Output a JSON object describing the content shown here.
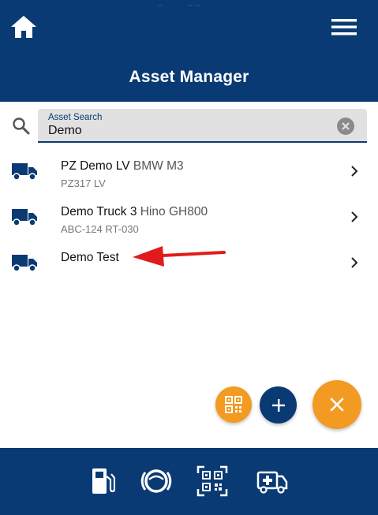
{
  "header": {
    "title": "Asset Manager",
    "background_color": "#0a3a73",
    "home_icon": "home-icon",
    "menu_icon": "hamburger-menu-icon"
  },
  "search": {
    "label": "Asset Search",
    "value": "Demo",
    "icon": "search-icon",
    "clear_icon": "clear-circle-icon"
  },
  "assets": [
    {
      "name": "PZ Demo LV",
      "model": "BMW M3",
      "subtitle": "PZ317 LV",
      "icon": "truck-icon"
    },
    {
      "name": "Demo Truck 3",
      "model": "Hino GH800",
      "subtitle": "ABC-124 RT-030",
      "icon": "truck-icon"
    },
    {
      "name": "Demo Test",
      "model": "",
      "subtitle": "",
      "icon": "truck-icon"
    }
  ],
  "annotation": {
    "type": "red-arrow",
    "points_to": "Demo Test",
    "color": "#e11b1b"
  },
  "fabs": [
    {
      "name": "qr-scan-fab",
      "icon": "qr-code-icon",
      "color": "#f39a22"
    },
    {
      "name": "add-asset-fab",
      "icon": "plus-icon",
      "color": "#0a3a73"
    },
    {
      "name": "close-fab",
      "icon": "close-icon",
      "color": "#f39a22"
    }
  ],
  "bottom_nav": [
    {
      "name": "fuel",
      "icon": "fuel-pump-icon"
    },
    {
      "name": "gauge",
      "icon": "gauge-icon"
    },
    {
      "name": "qr-scan",
      "icon": "qr-code-icon"
    },
    {
      "name": "ambulance",
      "icon": "ambulance-icon"
    }
  ],
  "colors": {
    "primary": "#0a3a73",
    "accent": "#f39a22",
    "arrow": "#e11b1b"
  }
}
